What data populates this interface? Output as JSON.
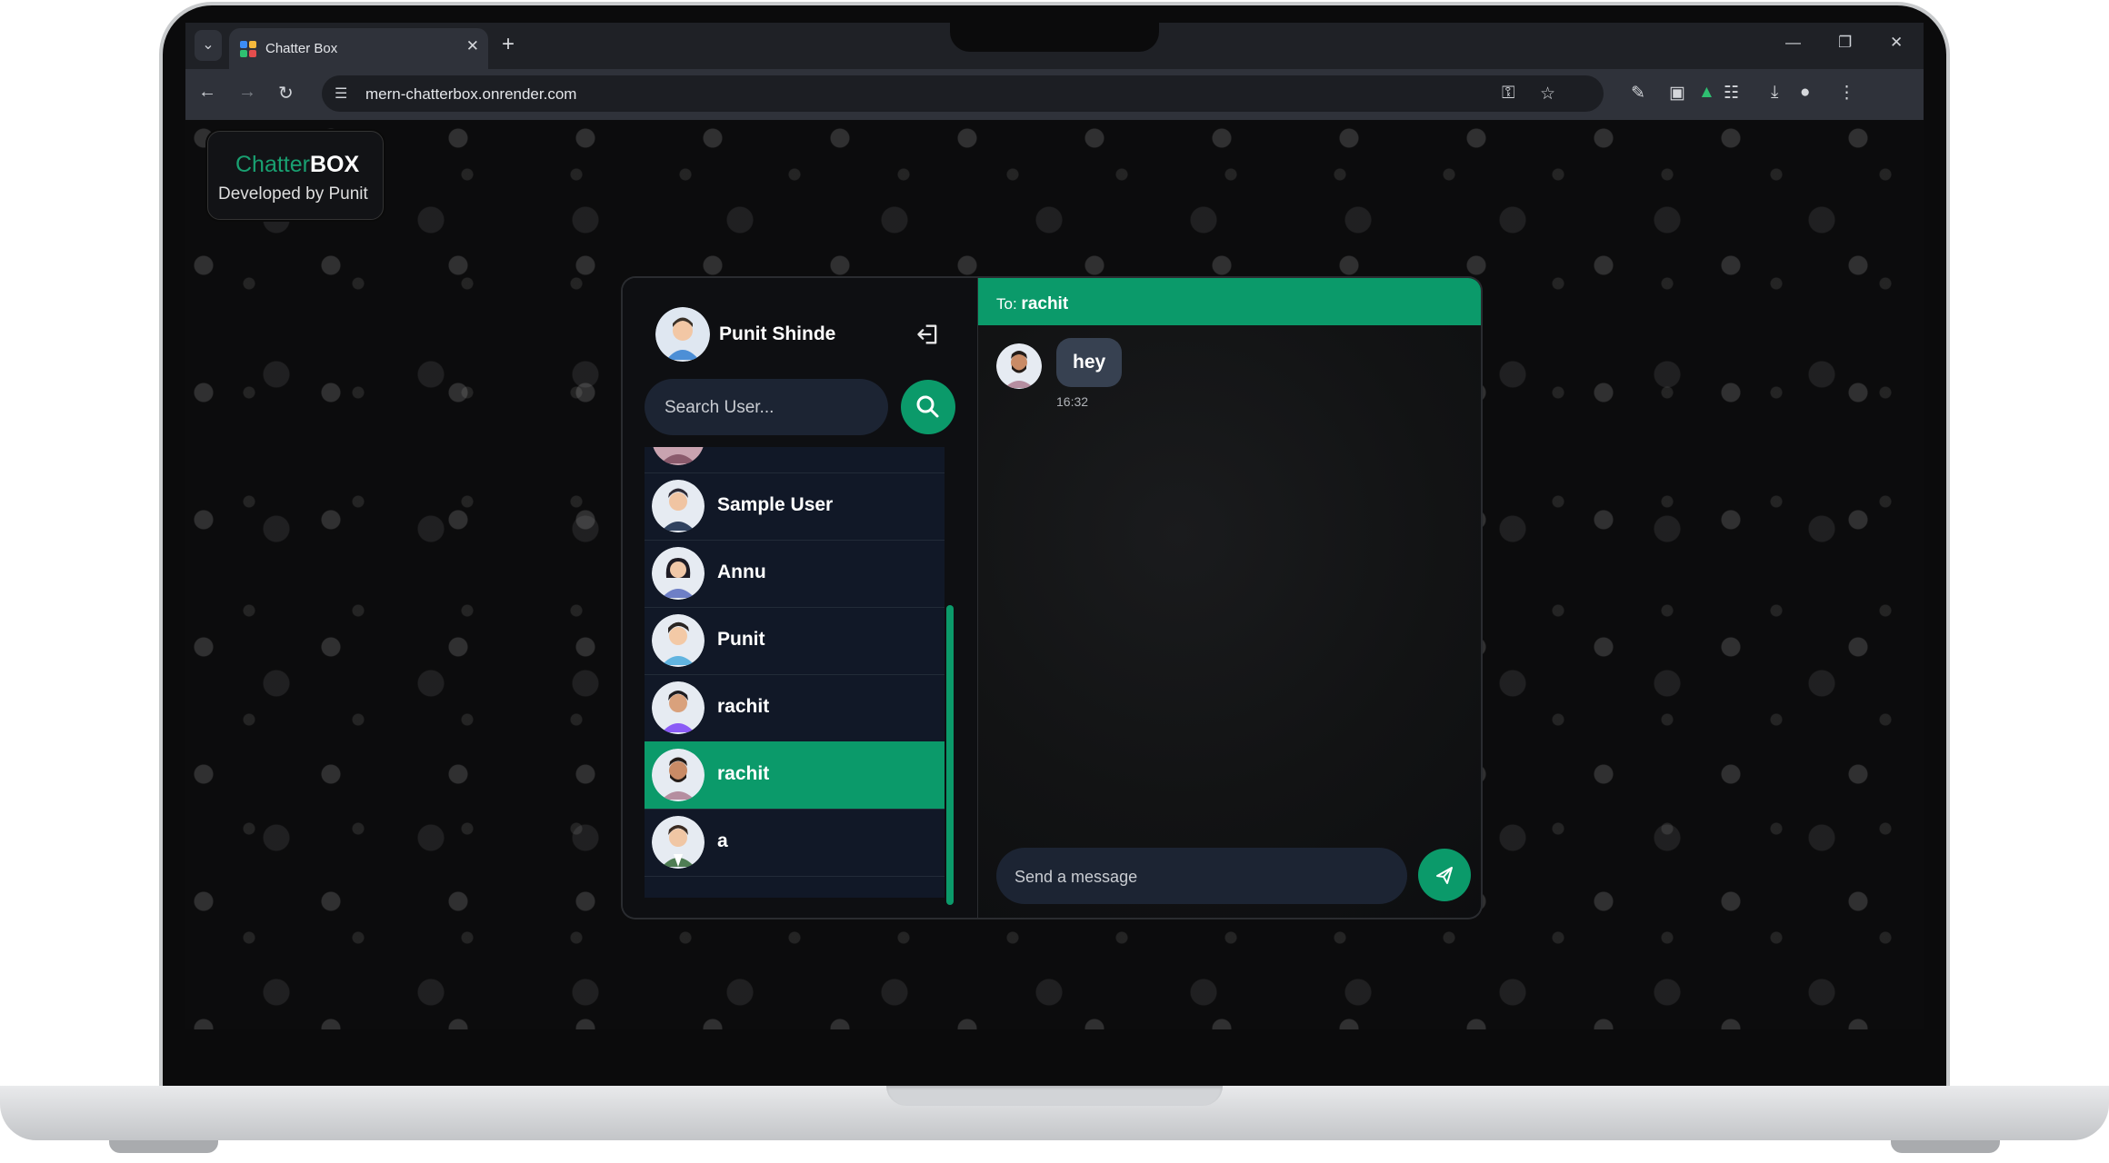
{
  "browser": {
    "tab_title": "Chatter Box",
    "url": "mern-chatterbox.onrender.com"
  },
  "brand": {
    "name_part1": "Chatter",
    "name_part2": "BOX",
    "subtitle": "Developed by Punit",
    "accent": "#19a071"
  },
  "sidebar": {
    "current_user": "Punit Shinde",
    "search_placeholder": "Search User...",
    "users": [
      {
        "name": "Sample User",
        "active": false
      },
      {
        "name": "Annu",
        "active": false
      },
      {
        "name": "Punit",
        "active": false
      },
      {
        "name": "rachit",
        "active": false
      },
      {
        "name": "rachit",
        "active": true
      },
      {
        "name": "a",
        "active": false
      }
    ]
  },
  "chat": {
    "to_label": "To:",
    "to_name": "rachit",
    "messages": [
      {
        "text": "hey",
        "time": "16:32"
      }
    ],
    "input_placeholder": "Send a message"
  },
  "colors": {
    "primary": "#0b9a6a",
    "panel": "#111827",
    "input": "#1c2433"
  }
}
